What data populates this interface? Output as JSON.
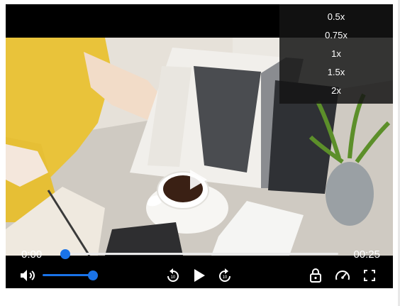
{
  "player": {
    "current_time": "0:00",
    "total_time": "00:25",
    "progress": 0,
    "volume": 1.0
  },
  "speed_menu": {
    "options": [
      "0.5x",
      "0.75x",
      "1x",
      "1.5x",
      "2x"
    ]
  },
  "icons": {
    "volume": "volume-icon",
    "rewind": "rewind-10-icon",
    "play": "play-icon",
    "forward": "forward-10-icon",
    "lock": "lock-icon",
    "speed": "speedometer-icon",
    "fullscreen": "fullscreen-icon"
  },
  "colors": {
    "accent": "#1a73e8",
    "player_bg": "#000000"
  }
}
